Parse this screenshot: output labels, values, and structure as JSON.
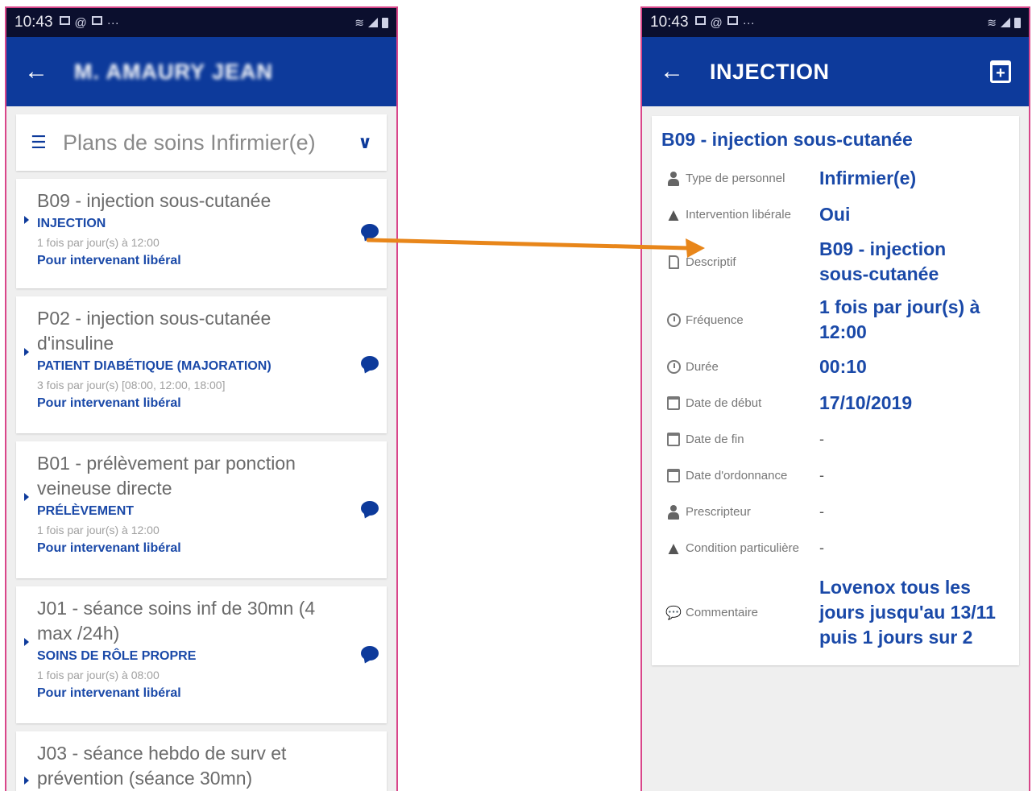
{
  "left": {
    "status": {
      "time": "10:43"
    },
    "appbar": {
      "title": "M. AMAURY JEAN"
    },
    "dropdown": {
      "label": "Plans de soins Infirmier(e)"
    },
    "cards": [
      {
        "title": "B09 - injection sous-cutanée",
        "subtitle": "INJECTION",
        "frequency": "1 fois par jour(s) à 12:00",
        "note": "Pour intervenant libéral"
      },
      {
        "title": "P02 - injection sous-cutanée d'insuline",
        "subtitle": "PATIENT DIABÉTIQUE (MAJORATION)",
        "frequency": "3 fois par jour(s) [08:00, 12:00, 18:00]",
        "note": "Pour intervenant libéral"
      },
      {
        "title": "B01 - prélèvement par ponction veineuse directe",
        "subtitle": "PRÉLÈVEMENT",
        "frequency": "1 fois par jour(s) à 12:00",
        "note": "Pour intervenant libéral"
      },
      {
        "title": "J01 - séance soins inf de 30mn (4 max /24h)",
        "subtitle": "SOINS DE RÔLE PROPRE",
        "frequency": "1 fois par jour(s) à 08:00",
        "note": "Pour intervenant libéral"
      },
      {
        "title": "J03 - séance hebdo de surv et prévention (séance 30mn)"
      }
    ]
  },
  "right": {
    "status": {
      "time": "10:43"
    },
    "appbar": {
      "title": "INJECTION"
    },
    "detail": {
      "title": "B09 - injection sous-cutanée",
      "rows": [
        {
          "label": "Type de personnel",
          "value": "Infirmier(e)"
        },
        {
          "label": "Intervention libérale",
          "value": "Oui"
        },
        {
          "label": "Descriptif",
          "value": "B09 - injection sous-cutanée"
        },
        {
          "label": "Fréquence",
          "value": "1 fois par jour(s) à 12:00"
        },
        {
          "label": "Durée",
          "value": "00:10"
        },
        {
          "label": "Date de début",
          "value": "17/10/2019"
        },
        {
          "label": "Date de fin",
          "value": "-"
        },
        {
          "label": "Date d'ordonnance",
          "value": "-"
        },
        {
          "label": "Prescripteur",
          "value": "-"
        },
        {
          "label": "Condition particulière",
          "value": "-"
        },
        {
          "label": "Commentaire",
          "value": "Lovenox tous les jours jusqu'au 13/11 puis 1 jours sur 2"
        }
      ]
    }
  },
  "colors": {
    "primary": "#0d3a9b",
    "accent_arrow": "#e8861a",
    "frame": "#d9468a"
  }
}
